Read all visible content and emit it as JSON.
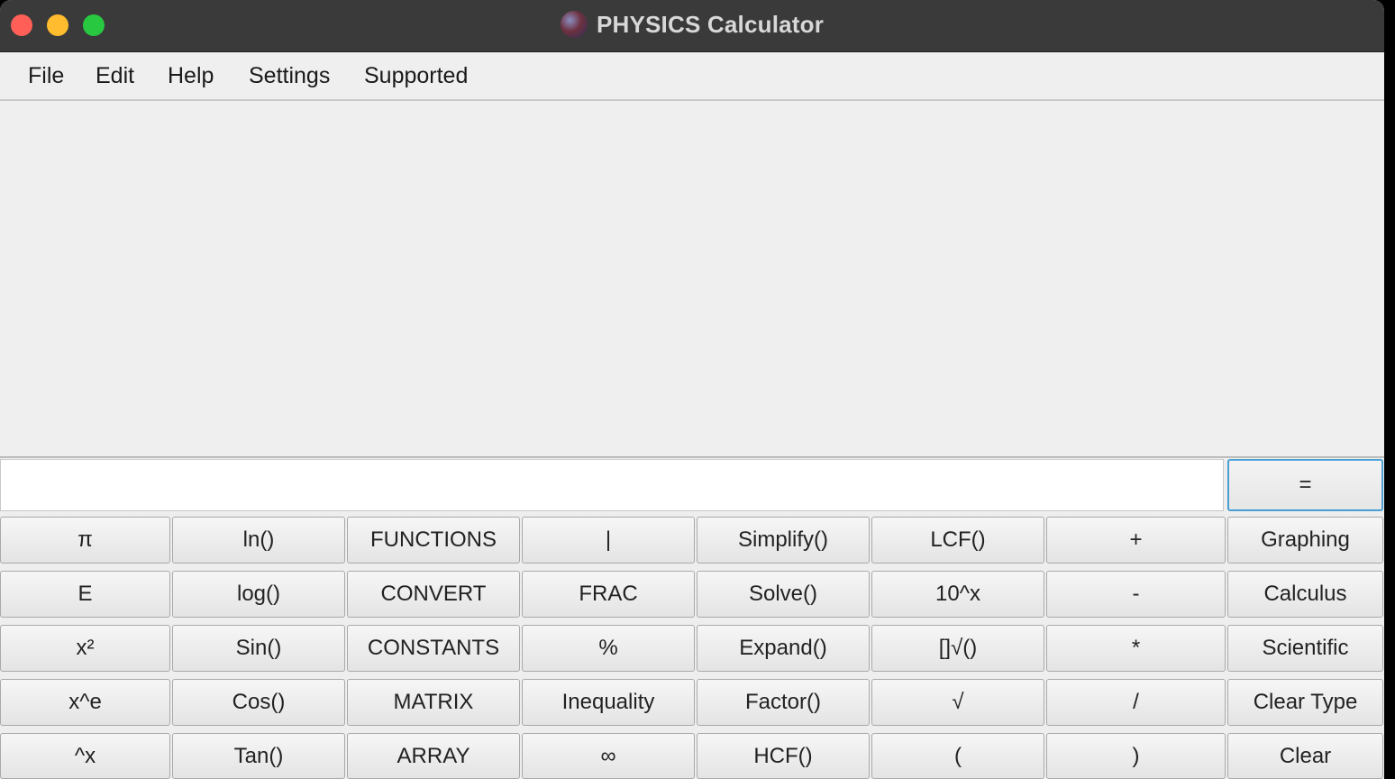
{
  "window": {
    "title": "PHYSICS Calculator",
    "colors": {
      "close": "#ff5f57",
      "minimize": "#febc2e",
      "maximize": "#28c840",
      "focus_ring": "#4a9fd4"
    }
  },
  "menu": [
    "File",
    "Edit",
    "Help",
    "Settings",
    "Supported"
  ],
  "input": {
    "value": ""
  },
  "equals_label": "=",
  "buttons": [
    [
      "π",
      "ln()",
      "FUNCTIONS",
      "|",
      "Simplify()",
      "LCF()",
      "+",
      "Graphing"
    ],
    [
      "E",
      "log()",
      "CONVERT",
      "FRAC",
      "Solve()",
      "10^x",
      "-",
      "Calculus"
    ],
    [
      "x²",
      "Sin()",
      "CONSTANTS",
      "%",
      "Expand()",
      "[]√()",
      "*",
      "Scientific"
    ],
    [
      "x^e",
      "Cos()",
      "MATRIX",
      "Inequality",
      "Factor()",
      "√",
      "/",
      "Clear Type"
    ],
    [
      "^x",
      "Tan()",
      "ARRAY",
      "∞",
      "HCF()",
      "(",
      ")",
      "Clear"
    ]
  ]
}
